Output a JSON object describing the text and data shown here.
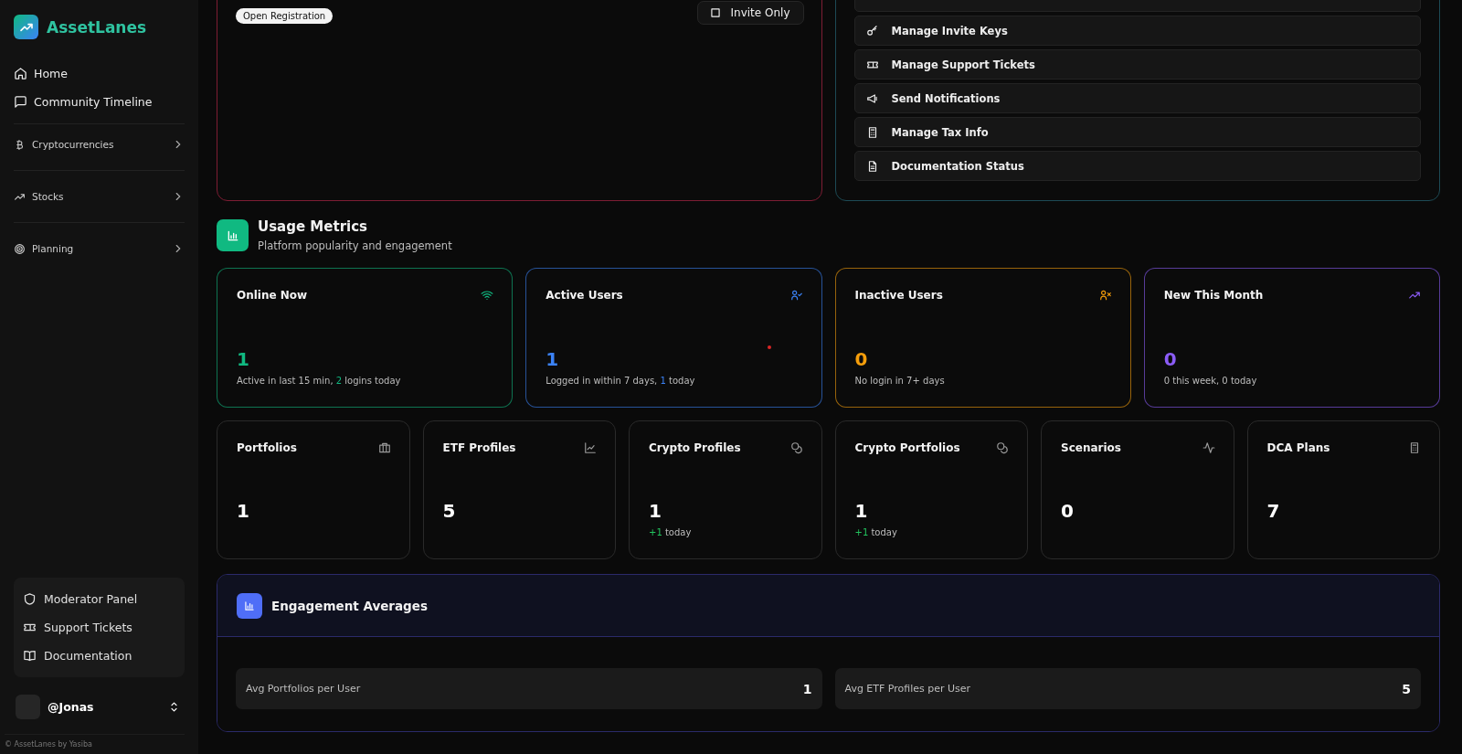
{
  "sidebar": {
    "brand": "AssetLanes",
    "nav": [
      {
        "label": "Home"
      },
      {
        "label": "Community Timeline"
      }
    ],
    "groups": [
      {
        "label": "Cryptocurrencies",
        "expanded": false
      },
      {
        "label": "Stocks",
        "expanded": false
      },
      {
        "label": "Planning",
        "expanded": false
      }
    ],
    "tools": [
      {
        "label": "Moderator Panel"
      },
      {
        "label": "Support Tickets"
      },
      {
        "label": "Documentation"
      }
    ],
    "user": {
      "handle": "@Jonas"
    },
    "footer": "© AssetLanes by Yasiba"
  },
  "registration": {
    "badge": "Open Registration",
    "option": "Invite Only"
  },
  "admin_actions": [
    {
      "label": "Manage Invite Keys"
    },
    {
      "label": "Manage Support Tickets"
    },
    {
      "label": "Send Notifications"
    },
    {
      "label": "Manage Tax Info"
    },
    {
      "label": "Documentation Status"
    }
  ],
  "usage": {
    "title": "Usage Metrics",
    "subtitle": "Platform popularity and engagement",
    "metrics": [
      {
        "title": "Online Now",
        "value": "1",
        "color": "#10b981",
        "detail": "Active in last 15 min, ",
        "detail_count": "2",
        "detail_after": " logins today"
      },
      {
        "title": "Active Users",
        "value": "1",
        "color": "#3b82f6",
        "dot": true,
        "detail": "Logged in within 7 days, ",
        "detail_count": "1",
        "detail_after": " today"
      },
      {
        "title": "Inactive Users",
        "value": "0",
        "color": "#f59e0b",
        "detail": "No login in 7+ days"
      },
      {
        "title": "New This Month",
        "value": "0",
        "color": "#8b5cf6",
        "detail": "0 this week, 0 today"
      }
    ],
    "counts": [
      {
        "title": "Portfolios",
        "value": "1"
      },
      {
        "title": "ETF Profiles",
        "value": "5"
      },
      {
        "title": "Crypto Profiles",
        "value": "1",
        "delta": "+1",
        "delta_note": " today"
      },
      {
        "title": "Crypto Portfolios",
        "value": "1",
        "delta": "+1",
        "delta_note": " today"
      },
      {
        "title": "Scenarios",
        "value": "0"
      },
      {
        "title": "DCA Plans",
        "value": "7"
      }
    ]
  },
  "engagement": {
    "title": "Engagement Averages",
    "stats": [
      {
        "label": "Avg Portfolios per User",
        "value": "1"
      },
      {
        "label": "Avg ETF Profiles per User",
        "value": "5"
      }
    ]
  }
}
